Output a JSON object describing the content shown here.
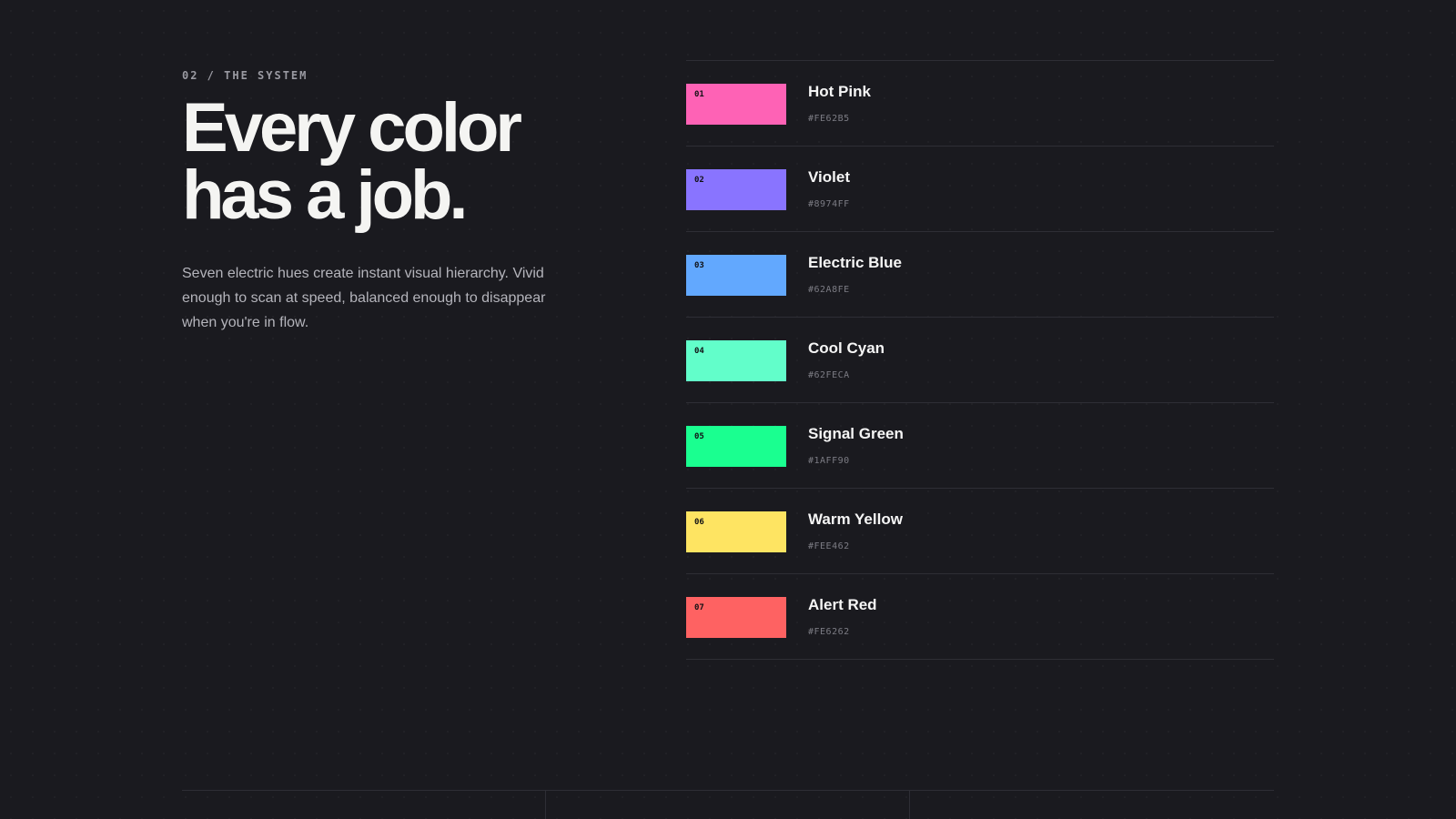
{
  "section": {
    "eyebrow": "02 / THE SYSTEM",
    "headline_line1": "Every color",
    "headline_line2": "has a job.",
    "lede": "Seven electric hues create instant visual hierarchy. Vivid enough to scan at speed, balanced enough to disappear when you're in flow."
  },
  "swatches": [
    {
      "num": "01",
      "name": "Hot Pink",
      "hex": "#FE62B5",
      "color": "#FE62B5"
    },
    {
      "num": "02",
      "name": "Violet",
      "hex": "#8974FF",
      "color": "#8974FF"
    },
    {
      "num": "03",
      "name": "Electric Blue",
      "hex": "#62A8FE",
      "color": "#62A8FE"
    },
    {
      "num": "04",
      "name": "Cool Cyan",
      "hex": "#62FECA",
      "color": "#62FECA"
    },
    {
      "num": "05",
      "name": "Signal Green",
      "hex": "#1AFF90",
      "color": "#1AFF90"
    },
    {
      "num": "06",
      "name": "Warm Yellow",
      "hex": "#FEE462",
      "color": "#FEE462"
    },
    {
      "num": "07",
      "name": "Alert Red",
      "hex": "#FE6262",
      "color": "#FE6262"
    }
  ]
}
